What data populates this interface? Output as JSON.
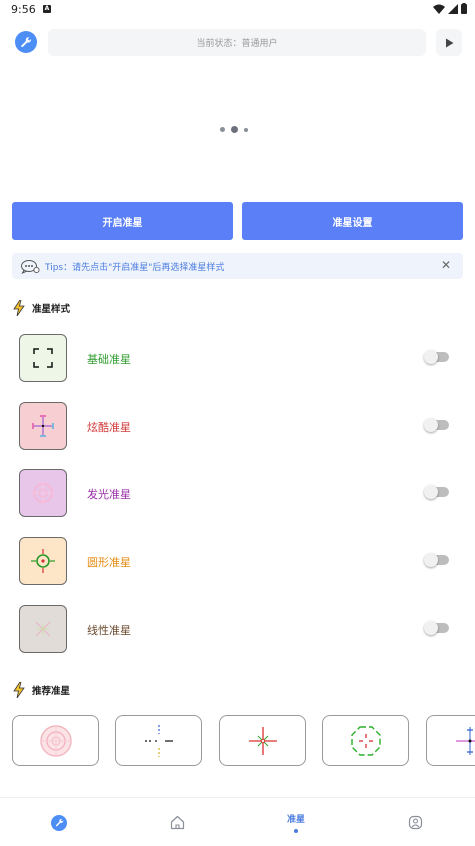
{
  "statusbar": {
    "time": "9:56"
  },
  "topbar": {
    "status_text": "当前状态：普通用户"
  },
  "actions": {
    "start_label": "开启准星",
    "settings_label": "准星设置"
  },
  "tips": {
    "text": "Tips：请先点击\"开启准星\"后再选择准星样式"
  },
  "styles_section": {
    "title": "准星样式",
    "items": [
      {
        "label": "基础准星",
        "label_color": "#2e9d2e",
        "thumb_bg": "#eef6e8",
        "icon": "basic-crosshair-icon",
        "enabled": false
      },
      {
        "label": "炫酷准星",
        "label_color": "#d23a3a",
        "thumb_bg": "#f7cfd2",
        "icon": "cool-crosshair-icon",
        "enabled": false
      },
      {
        "label": "发光准星",
        "label_color": "#9a2fa8",
        "thumb_bg": "#e7c6ea",
        "icon": "glow-crosshair-icon",
        "enabled": false
      },
      {
        "label": "圆形准星",
        "label_color": "#e58b12",
        "thumb_bg": "#fde5c7",
        "icon": "circle-crosshair-icon",
        "enabled": false
      },
      {
        "label": "线性准星",
        "label_color": "#6b4a2e",
        "thumb_bg": "#e2dcd8",
        "icon": "line-crosshair-icon",
        "enabled": false
      }
    ]
  },
  "recommend_section": {
    "title": "推荐准星",
    "items": [
      {
        "icon": "target-circle-crosshair-icon"
      },
      {
        "icon": "dashed-crosshair-icon"
      },
      {
        "icon": "red-cross-crosshair-icon"
      },
      {
        "icon": "green-octagon-crosshair-icon"
      },
      {
        "icon": "arrow-crosshair-icon"
      }
    ]
  },
  "bottom_nav": {
    "items": [
      {
        "icon": "wrench-icon",
        "label": ""
      },
      {
        "icon": "home-icon",
        "label": ""
      },
      {
        "icon": "crosshair-tab",
        "label": "准星",
        "active": true
      },
      {
        "icon": "user-icon",
        "label": ""
      }
    ]
  },
  "colors": {
    "accent": "#5b7ff7",
    "tips_bg": "#eff3fb",
    "tips_text": "#4b7de0"
  }
}
